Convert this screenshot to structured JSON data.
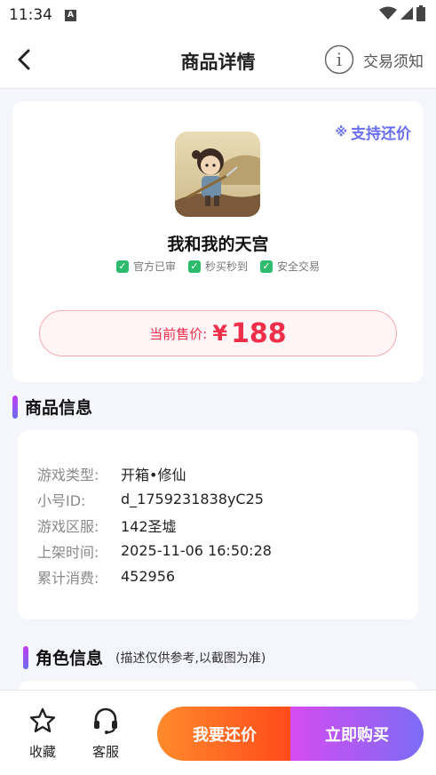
{
  "status": {
    "time": "11:34",
    "a_icon": "A"
  },
  "header": {
    "title": "商品详情",
    "notice_label": "交易须知",
    "info_glyph": "i"
  },
  "product": {
    "bargain_symbol": "※",
    "bargain_tag": "支持还价",
    "name": "我和我的天宫",
    "badges": [
      "官方已审",
      "秒买秒到",
      "安全交易"
    ],
    "price_label": "当前售价:",
    "currency": "¥",
    "price": "188"
  },
  "goods_info": {
    "title": "商品信息",
    "rows": [
      {
        "key": "游戏类型:",
        "value": "开箱•修仙"
      },
      {
        "key": "小号ID:",
        "value": "d_1759231838yC25"
      },
      {
        "key": "游戏区服:",
        "value": "142圣墟"
      },
      {
        "key": "上架时间:",
        "value": "2025-11-06 16:50:28"
      },
      {
        "key": "累计消费:",
        "value": "452956"
      }
    ]
  },
  "role_info": {
    "title": "角色信息",
    "note": "(描述仅供参考,以截图为准)"
  },
  "bottom": {
    "favorite": "收藏",
    "service": "客服",
    "bargain_button": "我要还价",
    "buy_button": "立即购买"
  },
  "colors": {
    "accent_purple": "#6a6ef0",
    "price_red": "#f0304a",
    "check_green": "#2fbb6e",
    "orange_start": "#ff8a2c",
    "pink_start": "#d64bf0"
  }
}
